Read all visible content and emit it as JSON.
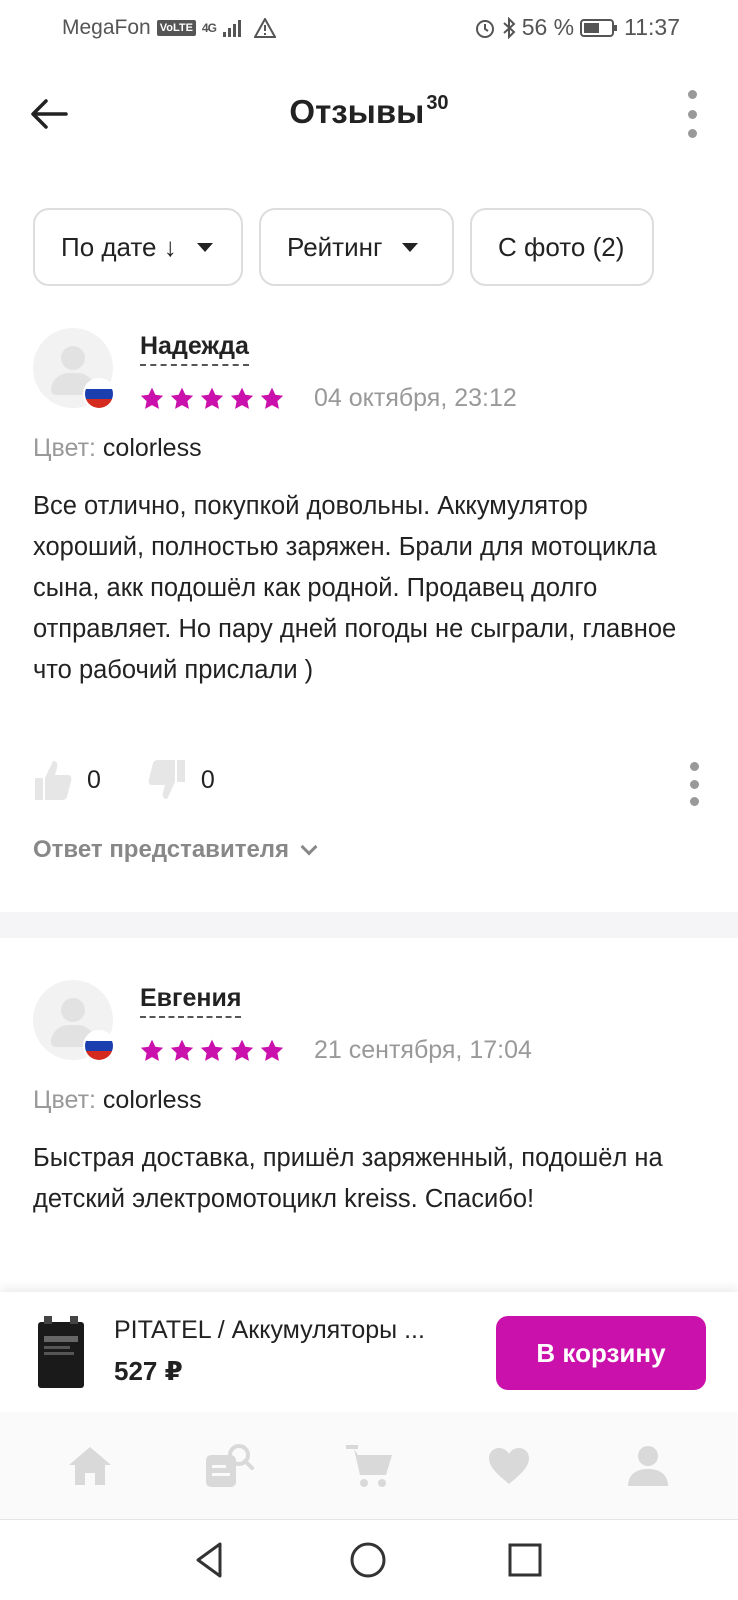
{
  "status_bar": {
    "carrier": "MegaFon",
    "volte": "VoLTE",
    "network": "4G",
    "battery": "56 %",
    "time": "11:37"
  },
  "header": {
    "title": "Отзывы",
    "count": "30"
  },
  "filters": [
    {
      "label": "По дате ↓"
    },
    {
      "label": "Рейтинг"
    },
    {
      "label": "С фото (2)"
    }
  ],
  "reviews": [
    {
      "name": "Надежда",
      "rating": 5,
      "date": "04 октября, 23:12",
      "color_label": "Цвет:",
      "color_value": "colorless",
      "text": "Все отлично, покупкой довольны. Аккумулятор хороший, полностью заряжен. Брали для мотоцикла сына, акк подошёл как родной. Продавец долго отправляет. Но пару дней погоды не сыграли, главное что рабочий прислали )",
      "likes": "0",
      "dislikes": "0",
      "reply_label": "Ответ представителя"
    },
    {
      "name": "Евгения",
      "rating": 5,
      "date": "21 сентября, 17:04",
      "color_label": "Цвет:",
      "color_value": "colorless",
      "text": "Быстрая доставка, пришёл заряженный, подошёл на детский электромотоцикл kreiss. Спасибо!"
    }
  ],
  "product": {
    "name": "PITATEL / Аккумуляторы ...",
    "price": "527 ₽",
    "cart_label": "В корзину"
  },
  "colors": {
    "accent": "#cb11ab",
    "star": "#cb11ab",
    "muted": "#999999"
  },
  "bottom_nav": [
    "home-icon",
    "catalog-search-icon",
    "cart-icon",
    "heart-icon",
    "profile-icon"
  ]
}
